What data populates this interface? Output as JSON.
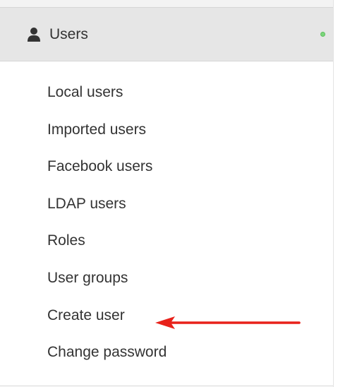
{
  "section": {
    "title": "Users",
    "icon": "user-icon",
    "status_color": "#7cd67c"
  },
  "menu": {
    "items": [
      {
        "label": "Local users"
      },
      {
        "label": "Imported users"
      },
      {
        "label": "Facebook users"
      },
      {
        "label": "LDAP users"
      },
      {
        "label": "Roles"
      },
      {
        "label": "User groups"
      },
      {
        "label": "Create user"
      },
      {
        "label": "Change password"
      }
    ]
  },
  "annotation": {
    "icon": "arrow-left-icon",
    "color": "#e8211a"
  }
}
